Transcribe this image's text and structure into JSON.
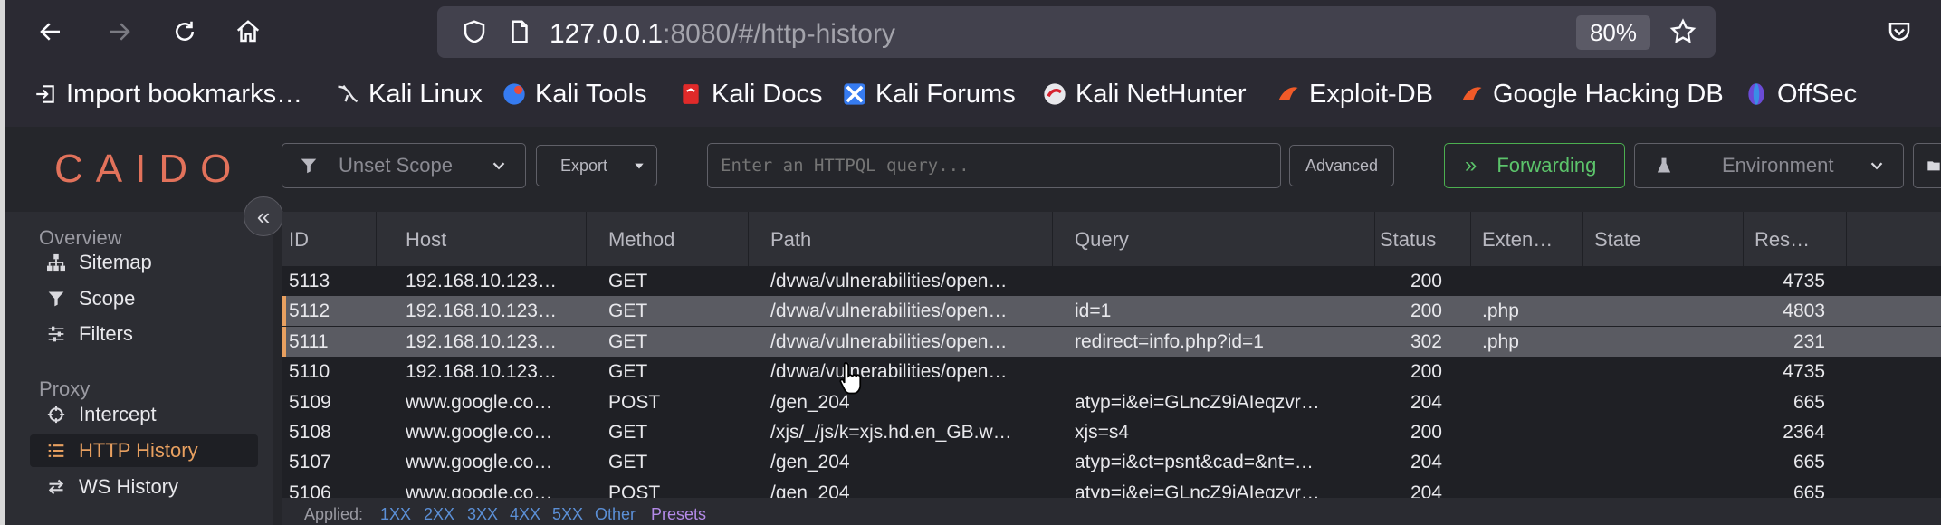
{
  "browser": {
    "url_host": "127.0.0.1",
    "url_rest": ":8080/#/http-history",
    "zoom": "80%",
    "bookmarks": [
      {
        "label": "Import bookmarks…",
        "icon": "import-icon"
      },
      {
        "label": "Kali Linux",
        "icon": "kali-dragon-icon"
      },
      {
        "label": "Kali Tools",
        "icon": "kali-tools-icon"
      },
      {
        "label": "Kali Docs",
        "icon": "kali-docs-icon"
      },
      {
        "label": "Kali Forums",
        "icon": "kali-forums-icon"
      },
      {
        "label": "Kali NetHunter",
        "icon": "nethunter-icon"
      },
      {
        "label": "Exploit-DB",
        "icon": "exploitdb-icon"
      },
      {
        "label": "Google Hacking DB",
        "icon": "ghdb-icon"
      },
      {
        "label": "OffSec",
        "icon": "offsec-icon"
      }
    ]
  },
  "app": {
    "logo": "CAIDO",
    "scope": "Unset Scope",
    "export": "Export",
    "query_placeholder": "Enter an HTTPQL query...",
    "advanced": "Advanced",
    "forwarding": "Forwarding",
    "environment": "Environment"
  },
  "sidebar": {
    "overview_label": "Overview",
    "proxy_label": "Proxy",
    "items": [
      {
        "label": "Sitemap",
        "icon": "sitemap-icon"
      },
      {
        "label": "Scope",
        "icon": "filter-icon"
      },
      {
        "label": "Filters",
        "icon": "sliders-icon"
      },
      {
        "label": "Intercept",
        "icon": "crosshair-icon"
      },
      {
        "label": "HTTP History",
        "icon": "list-icon"
      },
      {
        "label": "WS History",
        "icon": "exchange-icon"
      }
    ]
  },
  "table": {
    "columns": [
      "ID",
      "Host",
      "Method",
      "Path",
      "Query",
      "Status",
      "Exten…",
      "State",
      "Res…"
    ],
    "rows": [
      {
        "id": "5113",
        "host": "192.168.10.123…",
        "method": "GET",
        "path": "/dvwa/vulnerabilities/open…",
        "query": "",
        "status": "200",
        "ext": "",
        "state": "",
        "res": "4735"
      },
      {
        "id": "5112",
        "host": "192.168.10.123…",
        "method": "GET",
        "path": "/dvwa/vulnerabilities/open…",
        "query": "id=1",
        "status": "200",
        "ext": ".php",
        "state": "",
        "res": "4803"
      },
      {
        "id": "5111",
        "host": "192.168.10.123…",
        "method": "GET",
        "path": "/dvwa/vulnerabilities/open…",
        "query": "redirect=info.php?id=1",
        "status": "302",
        "ext": ".php",
        "state": "",
        "res": "231"
      },
      {
        "id": "5110",
        "host": "192.168.10.123…",
        "method": "GET",
        "path": "/dvwa/vulnerabilities/open…",
        "query": "",
        "status": "200",
        "ext": "",
        "state": "",
        "res": "4735"
      },
      {
        "id": "5109",
        "host": "www.google.co…",
        "method": "POST",
        "path": "/gen_204",
        "query": "atyp=i&ei=GLncZ9iAIeqzvr…",
        "status": "204",
        "ext": "",
        "state": "",
        "res": "665"
      },
      {
        "id": "5108",
        "host": "www.google.co…",
        "method": "GET",
        "path": "/xjs/_/js/k=xjs.hd.en_GB.w…",
        "query": "xjs=s4",
        "status": "200",
        "ext": "",
        "state": "",
        "res": "2364"
      },
      {
        "id": "5107",
        "host": "www.google.co…",
        "method": "GET",
        "path": "/gen_204",
        "query": "atyp=i&ct=psnt&cad=&nt=…",
        "status": "204",
        "ext": "",
        "state": "",
        "res": "665"
      },
      {
        "id": "5106",
        "host": "www.google.co…",
        "method": "POST",
        "path": "/gen_204",
        "query": "atyp=i&ei=GLncZ9iAIeqzvr…",
        "status": "204",
        "ext": "",
        "state": "",
        "res": "665"
      }
    ]
  },
  "footer": {
    "applied": "Applied:",
    "filters": [
      "1XX",
      "2XX",
      "3XX",
      "4XX",
      "5XX",
      "Other"
    ],
    "presets": "Presets"
  },
  "colors": {
    "accent": "#e8a060",
    "forwarding": "#5cc46b",
    "logo": "#e2725b"
  }
}
